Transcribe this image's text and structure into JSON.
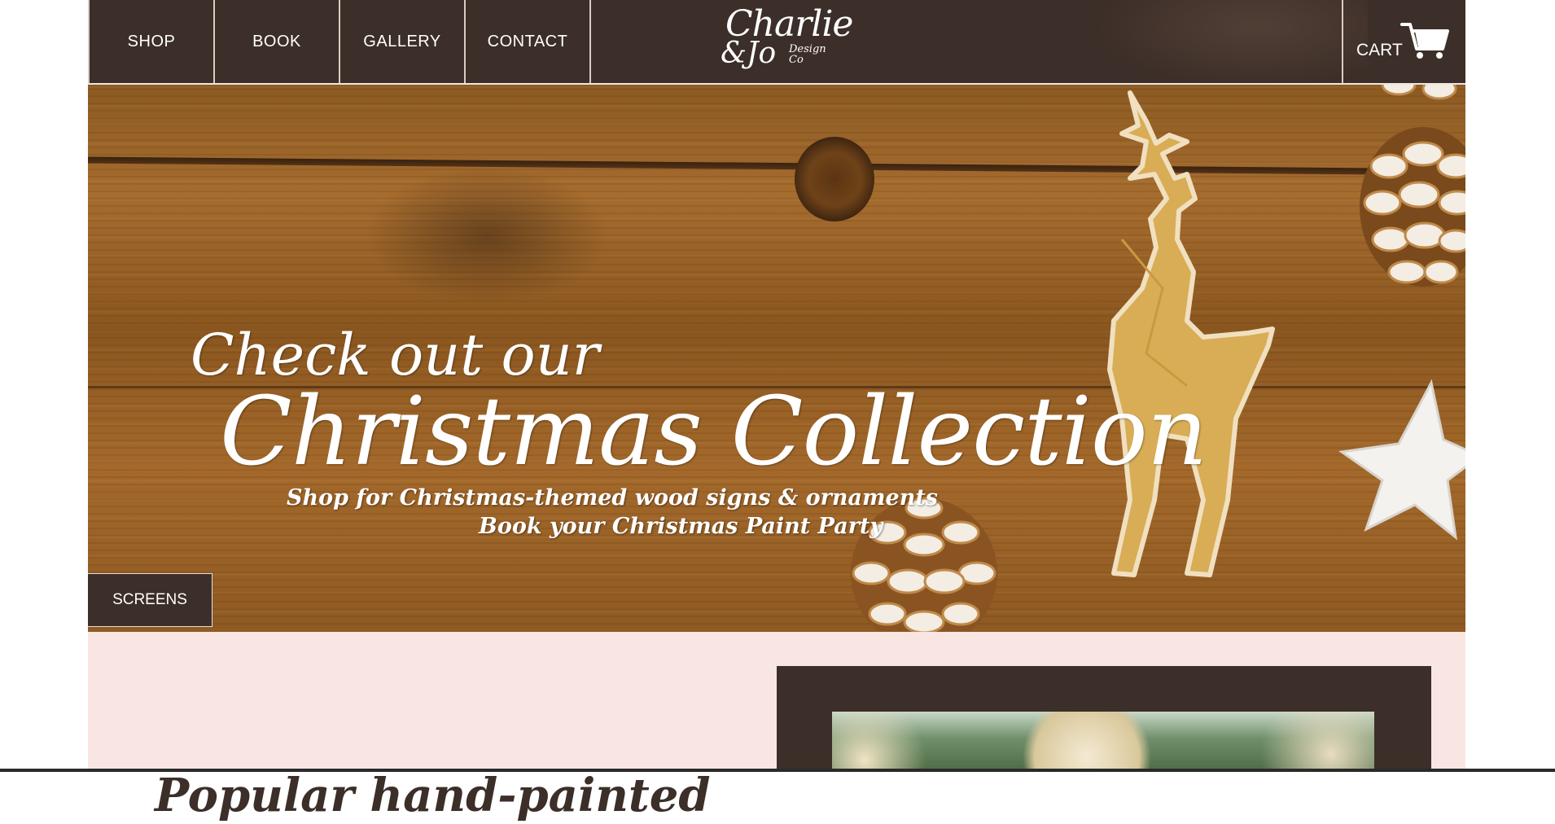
{
  "nav": {
    "items": [
      {
        "label": "SHOP"
      },
      {
        "label": "BOOK"
      },
      {
        "label": "GALLERY"
      },
      {
        "label": "CONTACT"
      }
    ]
  },
  "logo": {
    "line1": "Charlie",
    "line2": "&Jo",
    "line3": "Design Co"
  },
  "cart": {
    "label": "CART",
    "icon": "cart-icon"
  },
  "hero": {
    "line1": "Check out our",
    "line2": "Christmas Collection",
    "sub1": "Shop for Christmas-themed wood signs & ornaments",
    "sub2": "Book your Christmas Paint Party",
    "screens_button": "SCREENS"
  },
  "section": {
    "title": "Popular hand-painted"
  },
  "colors": {
    "header_bg": "#3c2e28",
    "section_bg": "#f9e6e3",
    "text": "#ffffff"
  }
}
